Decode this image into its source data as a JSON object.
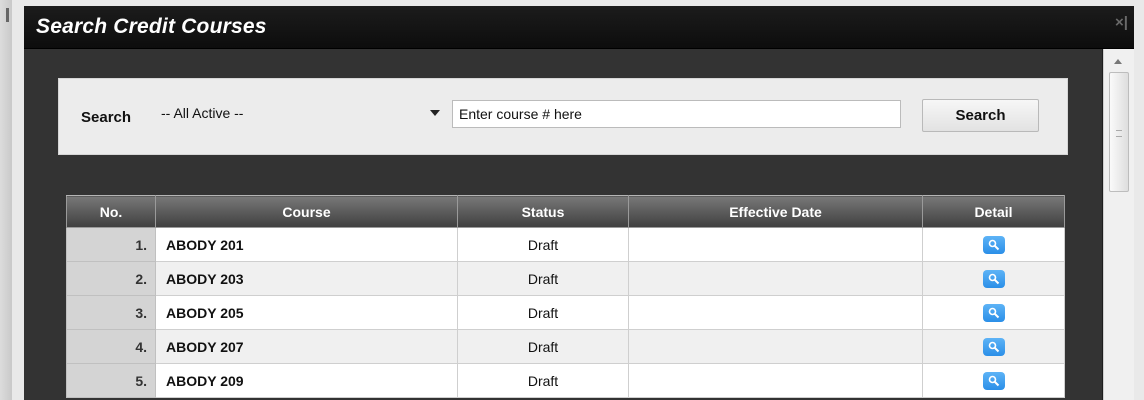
{
  "dialog": {
    "title": "Search Credit Courses",
    "close_symbol": "×|"
  },
  "search": {
    "label": "Search",
    "scope_value": "-- All Active --",
    "input_placeholder": "Enter course # here",
    "button_label": "Search"
  },
  "table": {
    "headers": {
      "no": "No.",
      "course": "Course",
      "status": "Status",
      "effective_date": "Effective Date",
      "detail": "Detail"
    },
    "rows": [
      {
        "no": "1.",
        "course": "ABODY 201",
        "status": "Draft",
        "effective_date": "",
        "detail_icon": "magnifier-icon"
      },
      {
        "no": "2.",
        "course": "ABODY 203",
        "status": "Draft",
        "effective_date": "",
        "detail_icon": "magnifier-icon"
      },
      {
        "no": "3.",
        "course": "ABODY 205",
        "status": "Draft",
        "effective_date": "",
        "detail_icon": "magnifier-icon"
      },
      {
        "no": "4.",
        "course": "ABODY 207",
        "status": "Draft",
        "effective_date": "",
        "detail_icon": "magnifier-icon"
      },
      {
        "no": "5.",
        "course": "ABODY 209",
        "status": "Draft",
        "effective_date": "",
        "detail_icon": "magnifier-icon"
      }
    ]
  },
  "colors": {
    "titlebar": "#111111",
    "content_bg": "#333333",
    "header_bg": "#5a5a5a",
    "detail_button": "#3a9cf0"
  }
}
